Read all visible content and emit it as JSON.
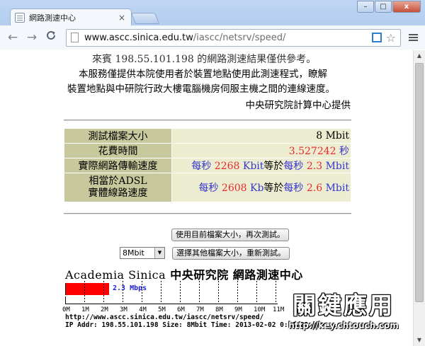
{
  "browser": {
    "tab_title": "網路測速中心",
    "tab_close": "×",
    "url_host": "www.ascc.sinica.edu.tw",
    "url_path": "/iascc/netsrv/speed/",
    "back_glyph": "←",
    "forward_glyph": "→",
    "reload_glyph": "C",
    "window_min": "–",
    "window_max": "□",
    "window_close": "x",
    "icons": [
      "page-icon",
      "bookmark-star-icon",
      "menu-icon",
      "back-icon",
      "forward-icon",
      "reload-icon"
    ]
  },
  "intro": {
    "greeting_prefix": "來賓 ",
    "visitor_ip": "198.55.101.198",
    "greeting_suffix": " 的網路測速結果僅供參考。",
    "line2": "本服務僅提供本院使用者於裝置地點使用此測速程式，瞭解",
    "line3": "裝置地點與中研院行政大樓電腦機房伺服主機之間的連線速度。",
    "provider": "中央研究院計算中心提供"
  },
  "results": {
    "file_size_label": "測試檔案大小",
    "file_size_value": "8 Mbit",
    "elapsed_label": "花費時間",
    "elapsed_value": "3.527242",
    "elapsed_unit": "秒",
    "actual_label": "實際網路傳輸速度",
    "per_sec": "每秒",
    "actual_kbit": "2268",
    "kbit_unit": "Kbit",
    "equals": "等於",
    "actual_mbit": "2.3",
    "mbit_unit": "Mbit",
    "adsl_label_1": "相當於ADSL",
    "adsl_label_2": "實體線路速度",
    "adsl_kb": "2608",
    "kb_unit": "Kb",
    "adsl_mbit": "2.6"
  },
  "controls": {
    "retest_button": "使用目前檔案大小，再次測試。",
    "select_value": "8Mbit",
    "select_arrow": "▼",
    "other_size_button": "選擇其他檔案大小，重新測試。"
  },
  "graph": {
    "banner_en": "Academia Sinica",
    "banner_cn": "中央研究院 網路測速中心",
    "speed_label": "2.3 Mbps",
    "speed_mbps": 2.3,
    "scale_max_mbps": 11,
    "tick_labels": [
      "0M",
      "1M",
      "2M",
      "3M",
      "4M",
      "5M",
      "6M",
      "7M",
      "8M",
      "9M",
      "10M",
      "11M"
    ],
    "bar_color": "#ff0000",
    "url_line": "http://www.ascc.sinica.edu.tw/iascc/netsrv/speed/",
    "ip_line": "IP Addr: 198.55.101.198 Size: 8Mbit Time: 2013-02-02 0:10:28"
  },
  "watermark": {
    "cn": "關鍵應用",
    "url": "http://key.chtouch.com"
  }
}
